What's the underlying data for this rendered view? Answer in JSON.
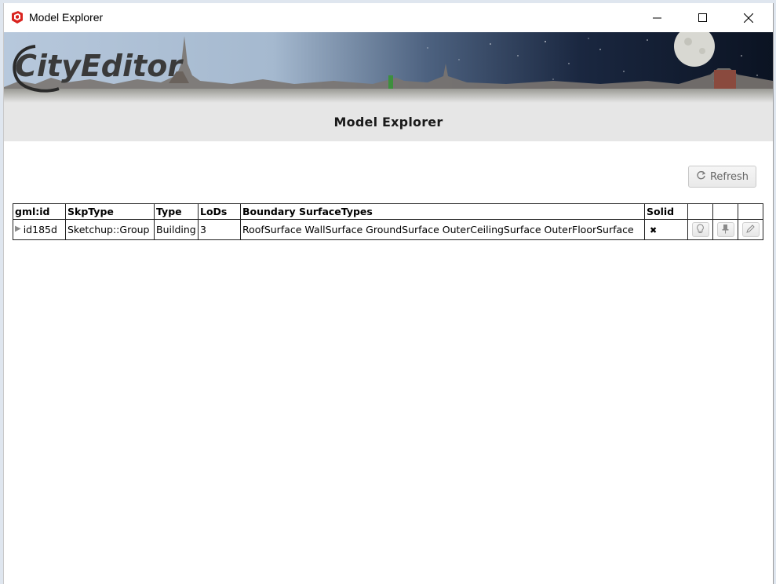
{
  "window": {
    "title": "Model Explorer",
    "icons": {
      "app": "sketchup-icon",
      "minimize": "minimize-icon",
      "maximize": "maximize-icon",
      "close": "close-icon"
    }
  },
  "banner": {
    "logo_text": "CityEditor"
  },
  "header": {
    "title": "Model Explorer"
  },
  "toolbar": {
    "refresh_label": "Refresh",
    "refresh_icon": "refresh-icon"
  },
  "table": {
    "columns": [
      "gml:id",
      "SkpType",
      "Type",
      "LoDs",
      "Boundary SurfaceTypes",
      "Solid",
      "",
      "",
      ""
    ],
    "rows": [
      {
        "gml_id": "id185d",
        "skp_type": "Sketchup::Group",
        "type": "Building",
        "lods": "3",
        "boundary_surface_types": "RoofSurface WallSurface GroundSurface OuterCeilingSurface OuterFloorSurface",
        "solid": "✖",
        "actions": [
          "lightbulb-icon",
          "pin-icon",
          "pencil-icon"
        ]
      }
    ]
  },
  "colors": {
    "subheader_bg": "#e6e6e6",
    "night_sky": "#0f1a2a",
    "day_sky": "#a9bfd6"
  }
}
